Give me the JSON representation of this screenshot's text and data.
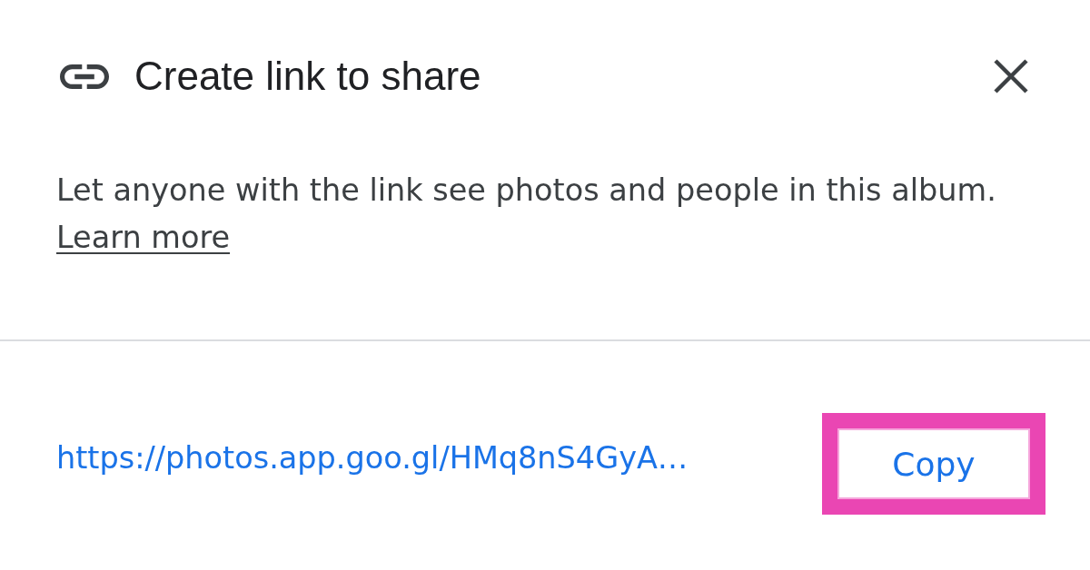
{
  "dialog": {
    "title": "Create link to share",
    "description": "Let anyone with the link see photos and people in this album.",
    "learn_more_link": "Learn more"
  },
  "share": {
    "url": "https://photos.app.goo.gl/HMq8nS4GyA…",
    "copy_button": {
      "label": "Copy",
      "highlighted": true
    }
  }
}
